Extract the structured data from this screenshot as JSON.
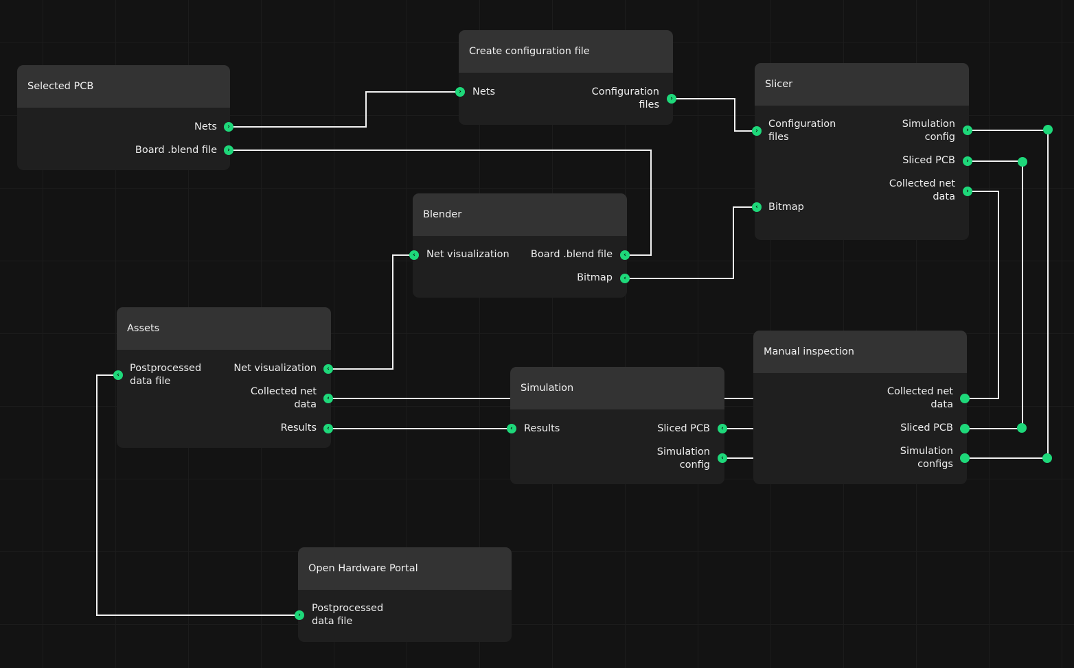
{
  "nodes": {
    "selected_pcb": {
      "title": "Selected PCB",
      "outputs": {
        "nets": "Nets",
        "board": "Board .blend file"
      }
    },
    "create_config": {
      "title": "Create configuration file",
      "inputs": {
        "nets": "Nets"
      },
      "outputs": {
        "config": [
          "Configuration",
          "files"
        ]
      }
    },
    "slicer": {
      "title": "Slicer",
      "inputs": {
        "config": [
          "Configuration",
          "files"
        ],
        "bitmap": "Bitmap"
      },
      "outputs": {
        "sim_config": [
          "Simulation",
          "config"
        ],
        "sliced": "Sliced PCB",
        "collected": [
          "Collected net",
          "data"
        ]
      }
    },
    "blender": {
      "title": "Blender",
      "inputs": {
        "net_vis": "Net visualization"
      },
      "outputs": {
        "board": "Board .blend file",
        "bitmap": "Bitmap"
      }
    },
    "assets": {
      "title": "Assets",
      "inputs": {
        "postprocessed": [
          "Postprocessed",
          "data file"
        ]
      },
      "outputs": {
        "net_vis": "Net visualization",
        "collected": [
          "Collected net",
          "data"
        ],
        "results": "Results"
      }
    },
    "simulation": {
      "title": "Simulation",
      "inputs": {
        "results": "Results"
      },
      "outputs": {
        "sliced": "Sliced PCB",
        "sim_config": [
          "Simulation",
          "config"
        ]
      }
    },
    "manual": {
      "title": "Manual inspection",
      "inputs": {
        "collected": [
          "Collected net",
          "data"
        ],
        "sliced": "Sliced PCB",
        "sim_configs": [
          "Simulation",
          "configs"
        ]
      }
    },
    "portal": {
      "title": "Open Hardware Portal",
      "inputs": {
        "postprocessed": [
          "Postprocessed",
          "data file"
        ]
      }
    }
  },
  "colors": {
    "accent": "#1ed87a",
    "canvas": "#131313",
    "node_body": "#1f1f1f",
    "node_header": "#333333",
    "wire": "#f2f2f2"
  }
}
